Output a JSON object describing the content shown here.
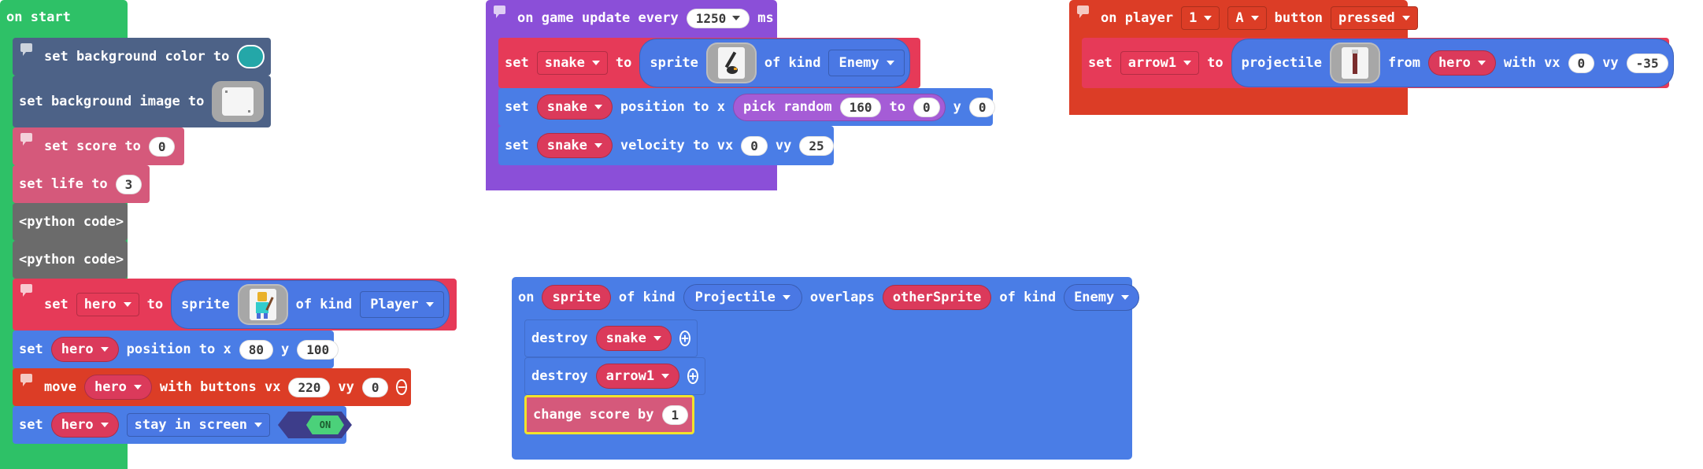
{
  "colors": {
    "green": "#2ec167",
    "purple": "#8b4fd8",
    "redorange": "#dc3d26",
    "blue": "#4a7de6",
    "navy": "#4d6287",
    "pink": "#d5597b",
    "gray": "#6b6b6b",
    "sprite_red": "#e63a58"
  },
  "on_start": {
    "title": "on start",
    "set_bg_color": {
      "label": "set background color to",
      "swatch": "#24a7a8"
    },
    "set_bg_image": {
      "label": "set background image to"
    },
    "set_score": {
      "label": "set score to",
      "value": "0"
    },
    "set_life": {
      "label": "set life to",
      "value": "3"
    },
    "python1": "<python code>",
    "python2": "<python code>",
    "set_hero": {
      "set": "set",
      "var": "hero",
      "to": "to",
      "sprite": "sprite",
      "of_kind": "of kind",
      "kind": "Player"
    },
    "hero_position": {
      "set": "set",
      "var": "hero",
      "label": "position to x",
      "x": "80",
      "y_label": "y",
      "y": "100"
    },
    "move": {
      "label": "move",
      "var": "hero",
      "with": "with buttons vx",
      "vx": "220",
      "vy_label": "vy",
      "vy": "0",
      "button_icon": "minus-icon"
    },
    "stay": {
      "set": "set",
      "var": "hero",
      "prop": "stay in screen",
      "toggle": "ON"
    }
  },
  "game_update": {
    "title_prefix": "on game update every",
    "interval": "1250",
    "unit": "ms",
    "set_snake": {
      "set": "set",
      "var": "snake",
      "to": "to",
      "sprite": "sprite",
      "of_kind": "of kind",
      "kind": "Enemy"
    },
    "snake_position": {
      "set": "set",
      "var": "snake",
      "label": "position to x",
      "pick": "pick random",
      "from": "160",
      "to_label": "to",
      "to": "0",
      "y_label": "y",
      "y": "0"
    },
    "snake_velocity": {
      "set": "set",
      "var": "snake",
      "label": "velocity to vx",
      "vx": "0",
      "vy_label": "vy",
      "vy": "25"
    }
  },
  "button_event": {
    "on_player": "on player",
    "player": "1",
    "button": "A",
    "button_label": "button",
    "action": "pressed",
    "set_arrow": {
      "set": "set",
      "var": "arrow1",
      "to": "to",
      "projectile": "projectile",
      "from": "from",
      "source": "hero",
      "with_vx": "with vx",
      "vx": "0",
      "vy_label": "vy",
      "vy": "-35"
    }
  },
  "overlap": {
    "on": "on",
    "sprite": "sprite",
    "of_kind": "of kind",
    "kind1": "Projectile",
    "overlaps": "overlaps",
    "other": "otherSprite",
    "of_kind2": "of kind",
    "kind2": "Enemy",
    "destroy1": {
      "label": "destroy",
      "var": "snake"
    },
    "destroy2": {
      "label": "destroy",
      "var": "arrow1"
    },
    "change": {
      "label": "change score by",
      "value": "1"
    }
  }
}
